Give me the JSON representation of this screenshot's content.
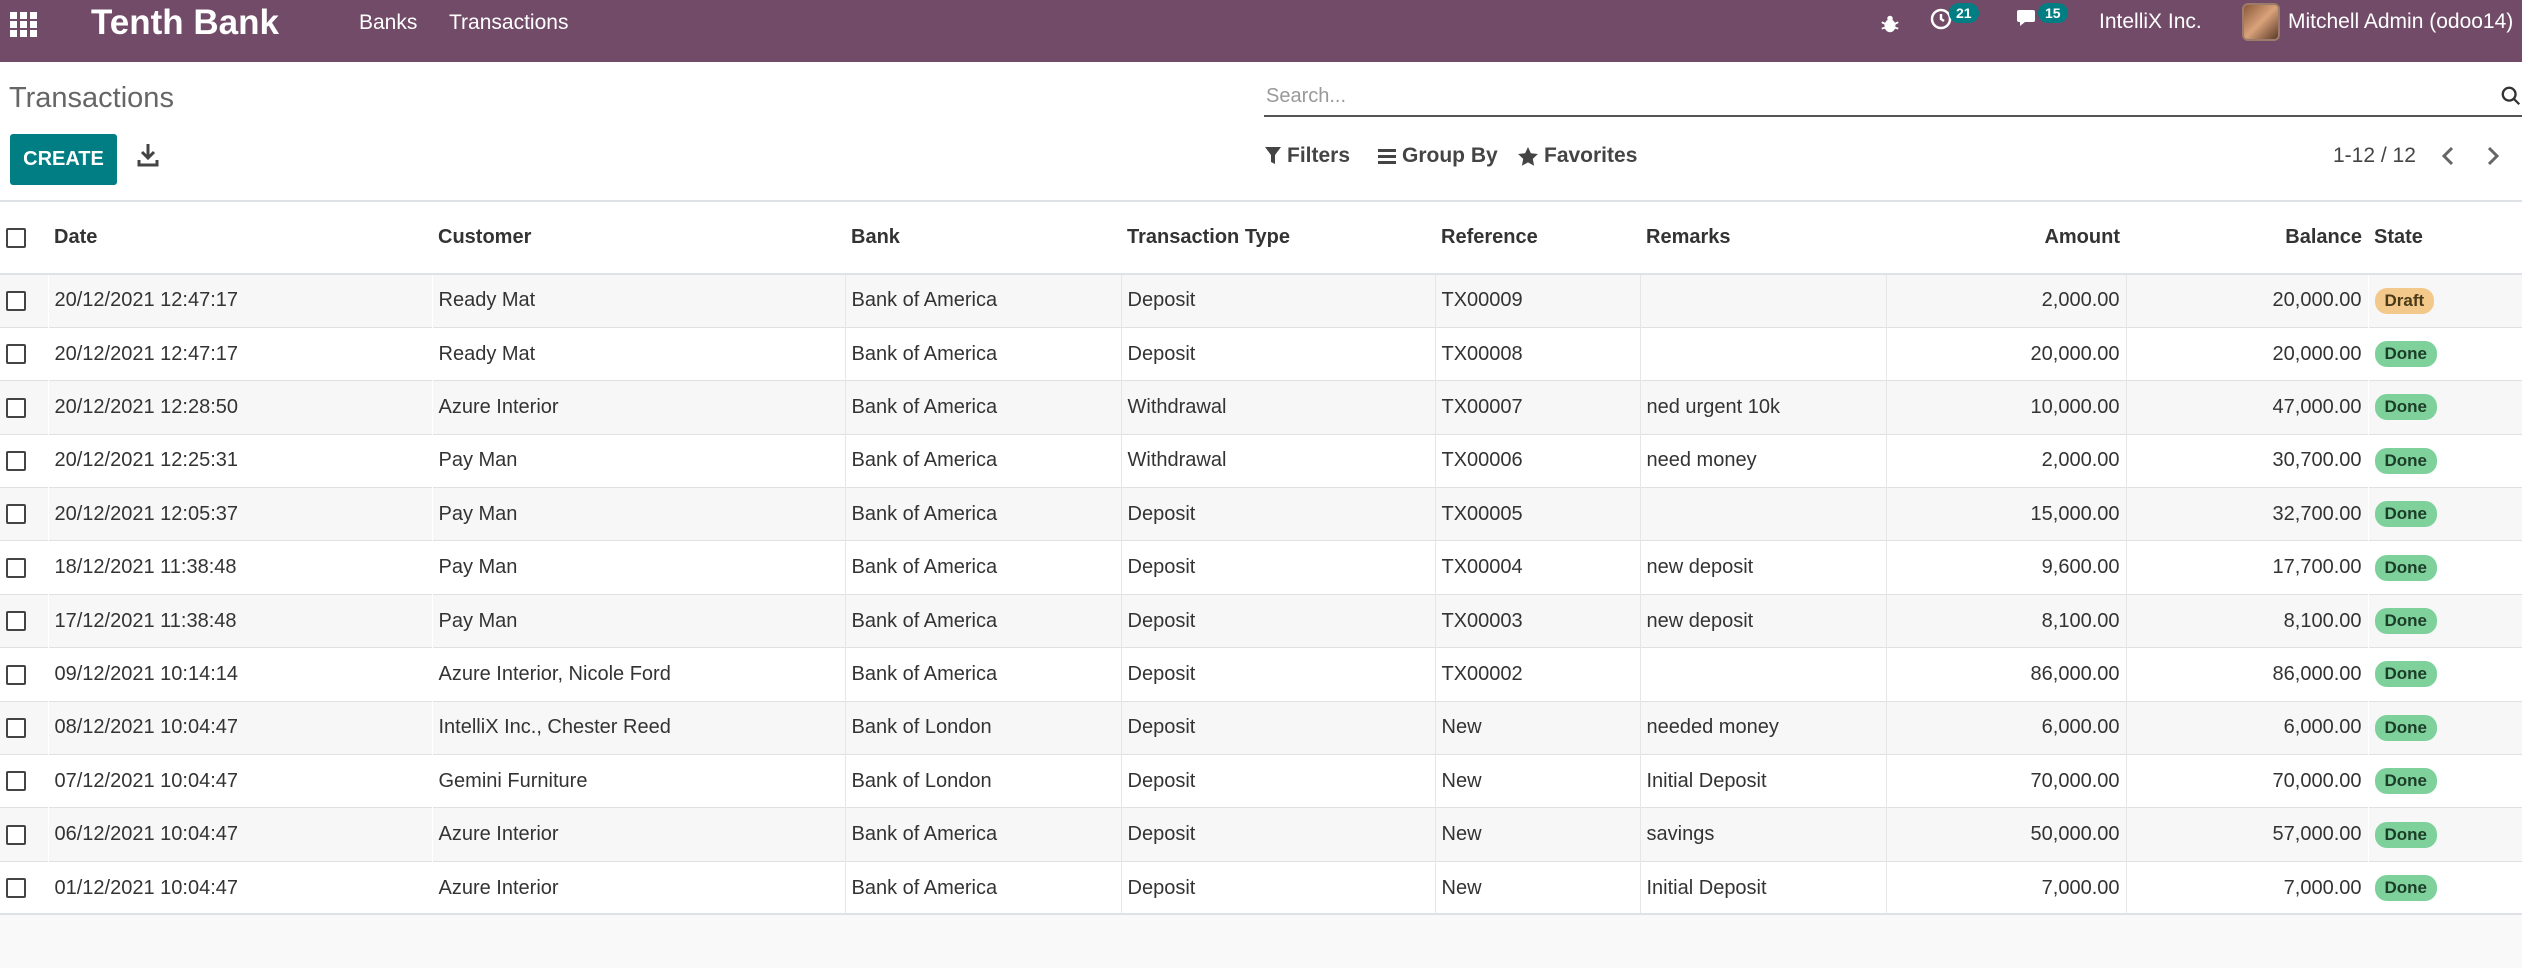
{
  "navbar": {
    "brand": "Tenth Bank",
    "menu": [
      "Banks",
      "Transactions"
    ],
    "activity_count": "21",
    "messages_count": "15",
    "company": "IntelliX Inc.",
    "user": "Mitchell Admin (odoo14)",
    "color": "#714b67"
  },
  "control_panel": {
    "title": "Transactions",
    "search_placeholder": "Search...",
    "create_label": "CREATE",
    "filters_label": "Filters",
    "groupby_label": "Group By",
    "favorites_label": "Favorites",
    "pager": "1-12 / 12"
  },
  "table": {
    "columns": [
      "Date",
      "Customer",
      "Bank",
      "Transaction Type",
      "Reference",
      "Remarks",
      "Amount",
      "Balance",
      "State"
    ],
    "rows": [
      [
        "20/12/2021 12:47:17",
        "Ready Mat",
        "Bank of America",
        "Deposit",
        "TX00009",
        "",
        "2,000.00",
        "20,000.00",
        "Draft"
      ],
      [
        "20/12/2021 12:47:17",
        "Ready Mat",
        "Bank of America",
        "Deposit",
        "TX00008",
        "",
        "20,000.00",
        "20,000.00",
        "Done"
      ],
      [
        "20/12/2021 12:28:50",
        "Azure Interior",
        "Bank of America",
        "Withdrawal",
        "TX00007",
        "ned urgent 10k",
        "10,000.00",
        "47,000.00",
        "Done"
      ],
      [
        "20/12/2021 12:25:31",
        "Pay Man",
        "Bank of America",
        "Withdrawal",
        "TX00006",
        "need money",
        "2,000.00",
        "30,700.00",
        "Done"
      ],
      [
        "20/12/2021 12:05:37",
        "Pay Man",
        "Bank of America",
        "Deposit",
        "TX00005",
        "",
        "15,000.00",
        "32,700.00",
        "Done"
      ],
      [
        "18/12/2021 11:38:48",
        "Pay Man",
        "Bank of America",
        "Deposit",
        "TX00004",
        "new deposit",
        "9,600.00",
        "17,700.00",
        "Done"
      ],
      [
        "17/12/2021 11:38:48",
        "Pay Man",
        "Bank of America",
        "Deposit",
        "TX00003",
        "new deposit",
        "8,100.00",
        "8,100.00",
        "Done"
      ],
      [
        "09/12/2021 10:14:14",
        "Azure Interior, Nicole Ford",
        "Bank of America",
        "Deposit",
        "TX00002",
        "",
        "86,000.00",
        "86,000.00",
        "Done"
      ],
      [
        "08/12/2021 10:04:47",
        "IntelliX Inc., Chester Reed",
        "Bank of London",
        "Deposit",
        "New",
        "needed money",
        "6,000.00",
        "6,000.00",
        "Done"
      ],
      [
        "07/12/2021 10:04:47",
        "Gemini Furniture",
        "Bank of London",
        "Deposit",
        "New",
        "Initial Deposit",
        "70,000.00",
        "70,000.00",
        "Done"
      ],
      [
        "06/12/2021 10:04:47",
        "Azure Interior",
        "Bank of America",
        "Deposit",
        "New",
        "savings",
        "50,000.00",
        "57,000.00",
        "Done"
      ],
      [
        "01/12/2021 10:04:47",
        "Azure Interior",
        "Bank of America",
        "Deposit",
        "New",
        "Initial Deposit",
        "7,000.00",
        "7,000.00",
        "Done"
      ]
    ]
  }
}
